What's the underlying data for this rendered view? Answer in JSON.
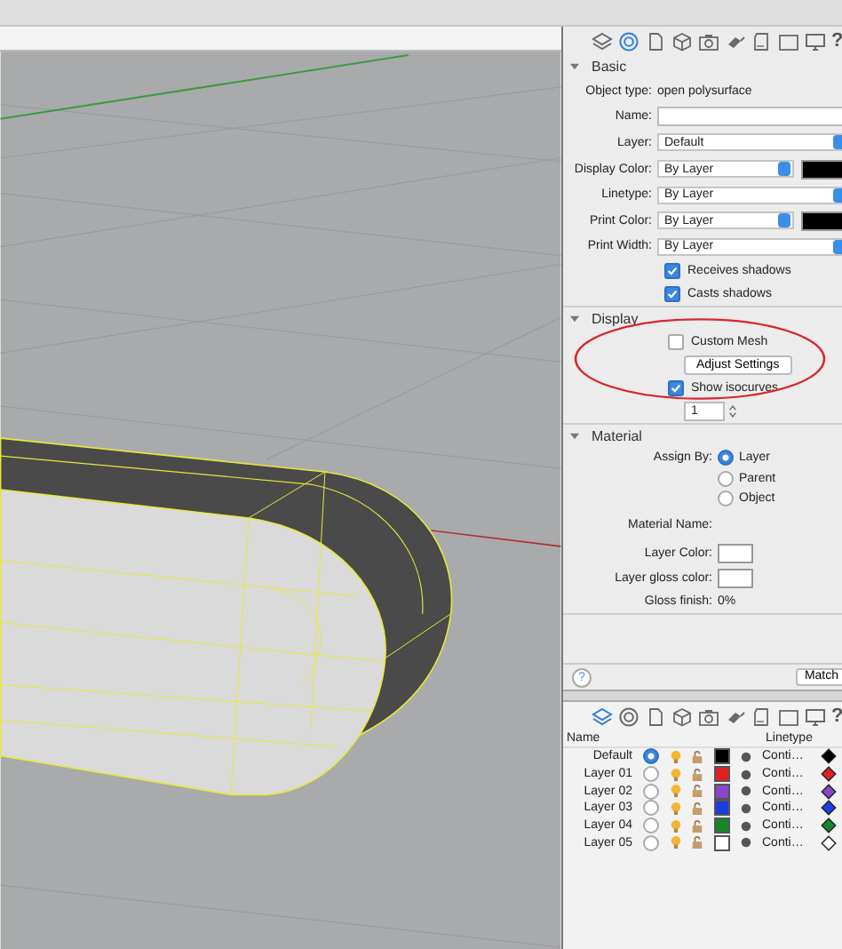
{
  "properties_toolbar": [
    {
      "kind": "layers",
      "selected": false
    },
    {
      "kind": "material",
      "selected": true
    },
    {
      "kind": "page",
      "selected": false
    },
    {
      "kind": "cube",
      "selected": false
    },
    {
      "kind": "camera",
      "selected": false
    },
    {
      "kind": "light",
      "selected": false
    },
    {
      "kind": "document",
      "selected": false
    },
    {
      "kind": "frame",
      "selected": false
    },
    {
      "kind": "monitor",
      "selected": false
    },
    {
      "kind": "help",
      "label": "?",
      "selected": false
    }
  ],
  "sections": [
    {
      "title": "Basic",
      "expanded": true,
      "kind": "basic",
      "rows": [
        {
          "kind": "text",
          "label": "Object type:",
          "value": "open polysurface"
        },
        {
          "kind": "field",
          "label": "Name:"
        },
        {
          "kind": "select",
          "label": "Layer:",
          "value": "Default"
        },
        {
          "kind": "select",
          "label": "Display Color:",
          "value": "By Layer",
          "color": "#000000"
        },
        {
          "kind": "select",
          "label": "Linetype:",
          "value": "By Layer"
        },
        {
          "kind": "select",
          "label": "Print Color:",
          "value": "By Layer",
          "color": "#000000"
        },
        {
          "kind": "select",
          "label": "Print Width:",
          "value": "By Layer"
        },
        {
          "kind": "checkbox",
          "label": "Receives shadows",
          "checked": true
        },
        {
          "kind": "checkbox",
          "label": "Casts shadows",
          "checked": true
        }
      ]
    },
    {
      "title": "Display",
      "expanded": true,
      "kind": "display",
      "rows": [
        {
          "kind": "checkbox",
          "label": "Custom Mesh",
          "checked": false
        },
        {
          "kind": "button",
          "label": "Adjust Settings"
        },
        {
          "kind": "checkbox",
          "label": "Show isocurves",
          "checked": true
        },
        {
          "kind": "spinner",
          "value": "1"
        }
      ]
    },
    {
      "title": "Material",
      "expanded": true,
      "kind": "material",
      "rows": [
        {
          "kind": "radio",
          "label": "Assign By:",
          "options": [
            {
              "label": "Layer",
              "selected": true
            },
            {
              "label": "Parent",
              "selected": false
            },
            {
              "label": "Object",
              "selected": false
            }
          ]
        },
        {
          "kind": "label",
          "label": "Material Name:"
        },
        {
          "kind": "swatch",
          "label": "Layer Color:",
          "color": "#ffffff"
        },
        {
          "kind": "swatch",
          "label": "Layer gloss color:",
          "color": "#ffffff"
        },
        {
          "kind": "text",
          "label": "Gloss finish:",
          "value": "0%"
        }
      ]
    }
  ],
  "footer": {
    "help": "?",
    "match_button": "Match"
  },
  "layers_toolbar": [
    {
      "kind": "layers",
      "selected": true
    },
    {
      "kind": "material",
      "selected": false
    },
    {
      "kind": "page",
      "selected": false
    },
    {
      "kind": "cube",
      "selected": false
    },
    {
      "kind": "camera",
      "selected": false
    },
    {
      "kind": "light",
      "selected": false
    },
    {
      "kind": "document",
      "selected": false
    },
    {
      "kind": "frame",
      "selected": false
    },
    {
      "kind": "monitor",
      "selected": false
    },
    {
      "kind": "help",
      "label": "?",
      "selected": false
    }
  ],
  "layers": {
    "columns": [
      "Name",
      "Linetype"
    ],
    "rows": [
      {
        "name": "Default",
        "selected": true,
        "color": "#000000",
        "linetype": "Conti…"
      },
      {
        "name": "Layer 01",
        "selected": false,
        "color": "#e02020",
        "linetype": "Conti…"
      },
      {
        "name": "Layer 02",
        "selected": false,
        "color": "#8a44c8",
        "linetype": "Conti…"
      },
      {
        "name": "Layer 03",
        "selected": false,
        "color": "#1a3ee0",
        "linetype": "Conti…"
      },
      {
        "name": "Layer 04",
        "selected": false,
        "color": "#16862a",
        "linetype": "Conti…"
      },
      {
        "name": "Layer 05",
        "selected": false,
        "color": "#ffffff",
        "linetype": "Conti…"
      }
    ]
  }
}
